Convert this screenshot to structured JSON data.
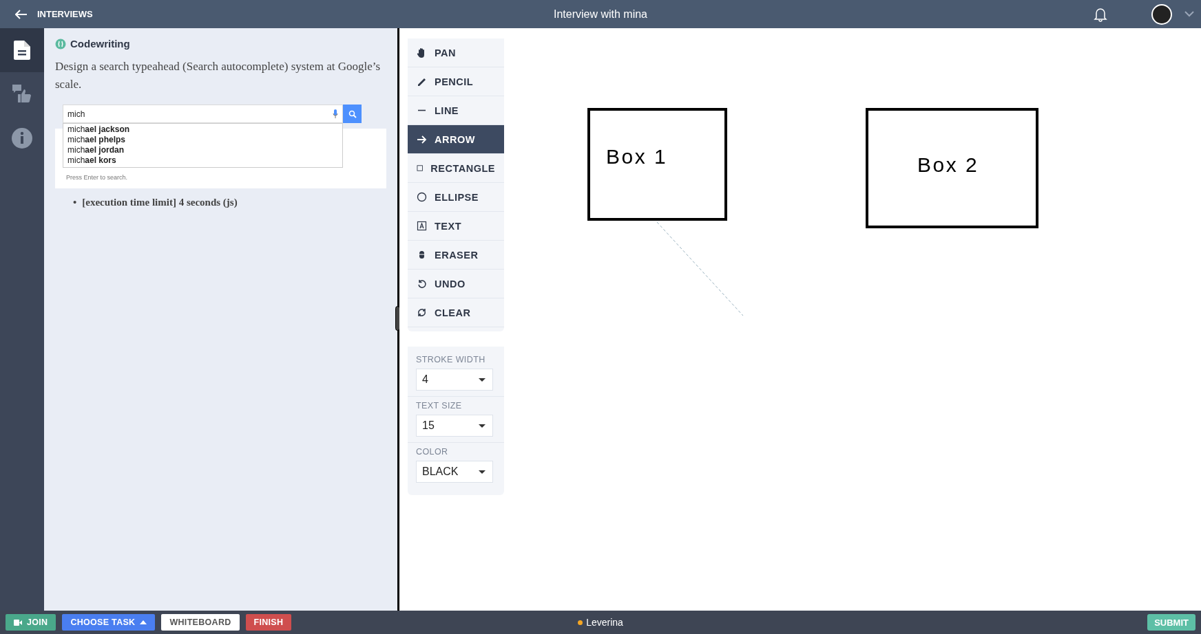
{
  "header": {
    "back_label": "INTERVIEWS",
    "title": "Interview with mina"
  },
  "sidebar": {
    "items": [
      {
        "kind": "document",
        "selected": true
      },
      {
        "kind": "feedback",
        "selected": false
      },
      {
        "kind": "info",
        "selected": false
      }
    ]
  },
  "task": {
    "type_label": "Codewriting",
    "description": "Design a search typeahead (Search autocomplete) system at Google’s scale.",
    "example": {
      "query": "mich",
      "suggestions": [
        "mich**ael jackson**",
        "mich**ael phelps**",
        "mich**ael jordan**",
        "mich**ael kors**"
      ],
      "hint": "Press Enter to search."
    },
    "notes": [
      {
        "marker": "•",
        "text": "[execution time limit] 4 seconds (js)"
      }
    ]
  },
  "tools": [
    {
      "label": "PAN",
      "kind": "pan",
      "selected": false
    },
    {
      "label": "PENCIL",
      "kind": "pencil",
      "selected": false
    },
    {
      "label": "LINE",
      "kind": "line",
      "selected": false
    },
    {
      "label": "ARROW",
      "kind": "arrow",
      "selected": true
    },
    {
      "label": "RECTANGLE",
      "kind": "rectangle",
      "selected": false
    },
    {
      "label": "ELLIPSE",
      "kind": "ellipse",
      "selected": false
    },
    {
      "label": "TEXT",
      "kind": "text",
      "selected": false
    },
    {
      "label": "ERASER",
      "kind": "eraser",
      "selected": false
    },
    {
      "label": "UNDO",
      "kind": "undo",
      "selected": false
    },
    {
      "label": "CLEAR",
      "kind": "clear",
      "selected": false
    }
  ],
  "settings": [
    {
      "label": "STROKE WIDTH",
      "value": "4"
    },
    {
      "label": "TEXT SIZE",
      "value": "15"
    },
    {
      "label": "COLOR",
      "value": "BLACK"
    }
  ],
  "canvas": {
    "shapes": [
      {
        "kind": "rectangle",
        "text": "Box 1"
      },
      {
        "kind": "rectangle",
        "text": "Box 2"
      },
      {
        "kind": "dashed-line"
      }
    ]
  },
  "footer": {
    "buttons": [
      {
        "label": "JOIN",
        "kind": "join"
      },
      {
        "label": "CHOOSE TASK",
        "kind": "choose"
      },
      {
        "label": "WHITEBOARD",
        "kind": "whiteboard"
      },
      {
        "label": "FINISH",
        "kind": "finish"
      }
    ],
    "user": {
      "name": "Leverina",
      "color": "#f5a623"
    },
    "submit": "SUBMIT"
  }
}
